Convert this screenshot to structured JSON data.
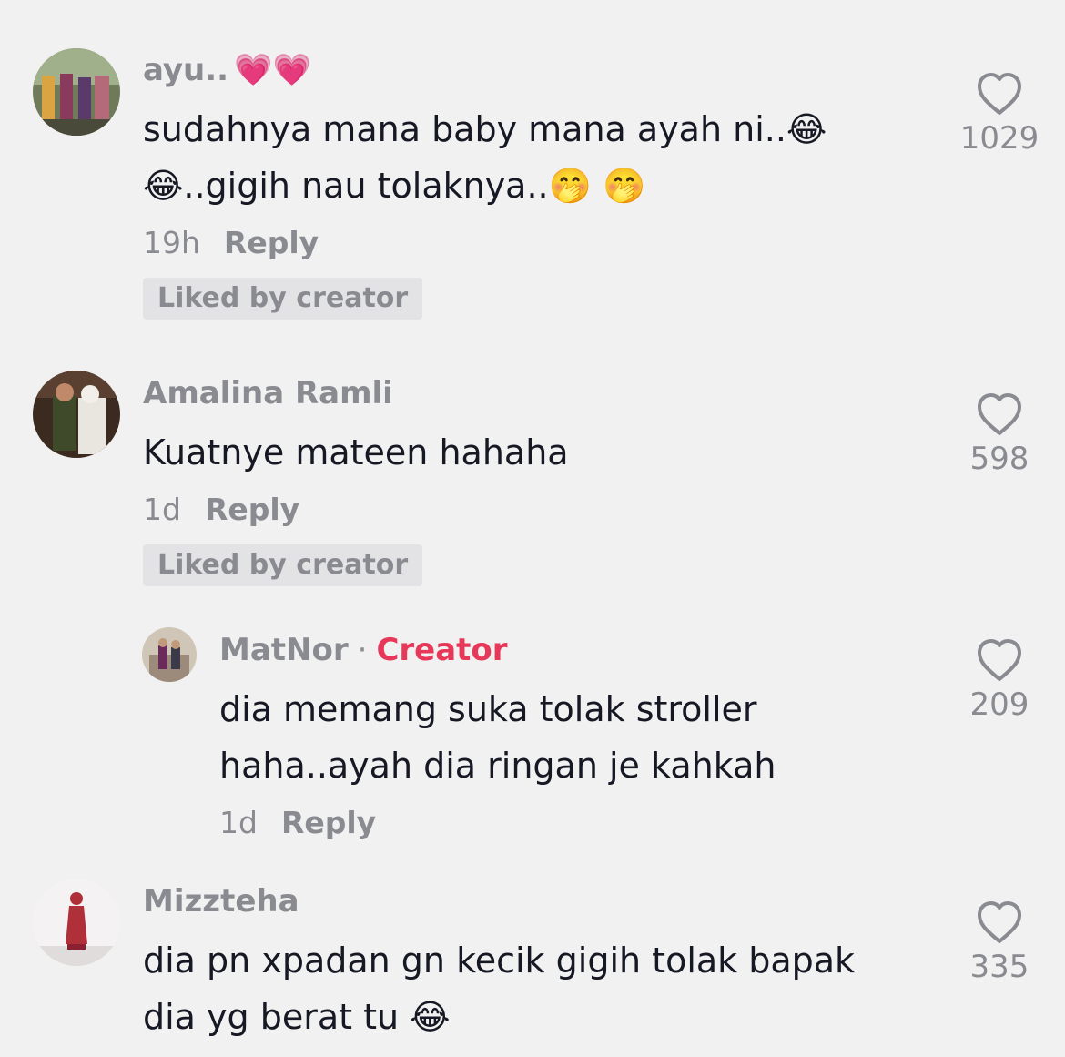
{
  "comments": [
    {
      "username": "ayu..",
      "username_emoji": "💗💗",
      "lines": [
        "sudahnya mana baby mana ayah ni..😂",
        "😂..gigih nau tolaknya..🤭 🤭"
      ],
      "time": "19h",
      "reply_label": "Reply",
      "badge": "Liked by creator",
      "likes": "1029"
    },
    {
      "username": "Amalina Ramli",
      "lines": [
        "Kuatnye mateen hahaha"
      ],
      "time": "1d",
      "reply_label": "Reply",
      "badge": "Liked by creator",
      "likes": "598"
    },
    {
      "username": "MatNor",
      "separator": "·",
      "creator_label": "Creator",
      "lines": [
        "dia memang suka tolak stroller",
        "haha..ayah dia ringan je kahkah"
      ],
      "time": "1d",
      "reply_label": "Reply",
      "likes": "209"
    },
    {
      "username": "Mizzteha",
      "lines": [
        "dia pn xpadan gn kecik gigih tolak bapak",
        "dia yg berat tu 😂"
      ],
      "likes": "335"
    }
  ],
  "icons": {
    "like": "heart-outline-icon",
    "avatar": "user-avatar"
  },
  "colors": {
    "background": "#f1f1f2",
    "text": "#161823",
    "muted": "#8a8b91",
    "creator": "#e8385a",
    "badge_bg": "#e3e3e5"
  }
}
